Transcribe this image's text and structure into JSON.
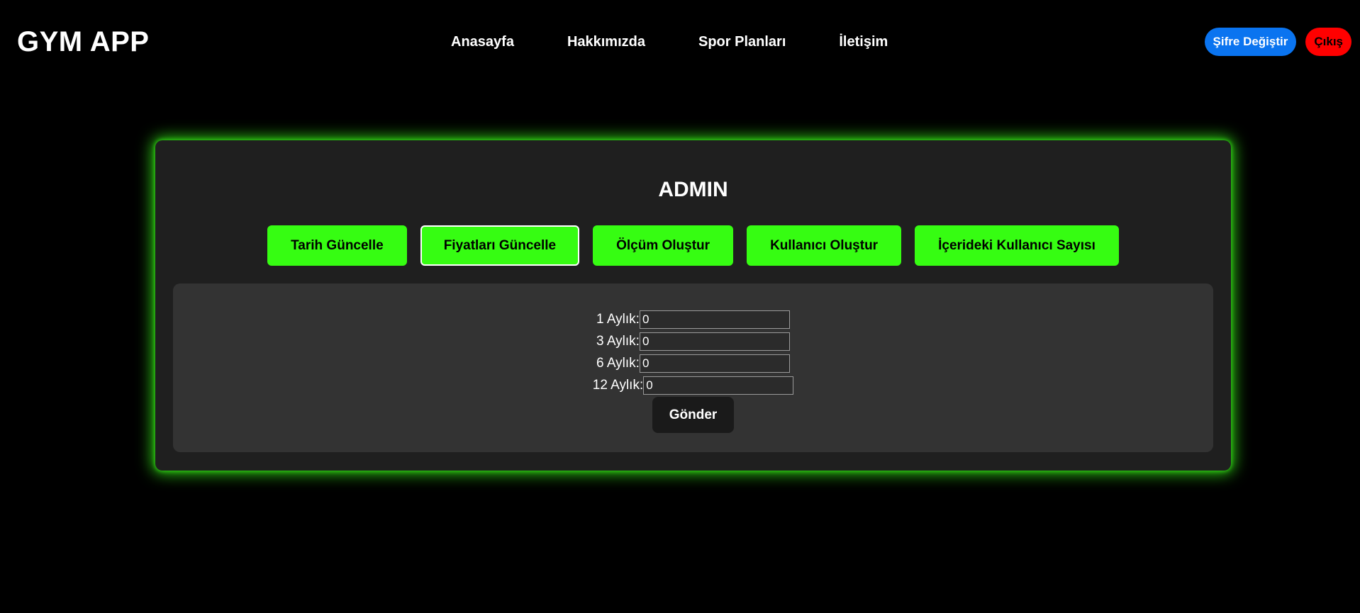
{
  "brand": {
    "title": "GYM APP"
  },
  "nav": {
    "links": [
      "Anasayfa",
      "Hakkımızda",
      "Spor Planları",
      "İletişim"
    ],
    "change_password_label": "Şifre Değiştir",
    "logout_label": "Çıkış"
  },
  "admin": {
    "title": "ADMIN",
    "tabs": [
      {
        "label": "Tarih Güncelle",
        "active": false
      },
      {
        "label": "Fiyatları Güncelle",
        "active": true
      },
      {
        "label": "Ölçüm Oluştur",
        "active": false
      },
      {
        "label": "Kullanıcı Oluştur",
        "active": false
      },
      {
        "label": "İçerideki Kullanıcı Sayısı",
        "active": false
      }
    ],
    "price_form": {
      "fields": [
        {
          "label": "1 Aylık:",
          "value": "0"
        },
        {
          "label": "3 Aylık:",
          "value": "0"
        },
        {
          "label": "6 Aylık:",
          "value": "0"
        },
        {
          "label": "12 Aylık:",
          "value": "0"
        }
      ],
      "submit_label": "Gönder"
    }
  },
  "colors": {
    "background": "#000000",
    "accent_green": "#36fd12",
    "blue_button": "#0a74f0",
    "red_button": "#ff0000",
    "card_bg": "#1f1f1f",
    "panel_bg": "#333333"
  }
}
